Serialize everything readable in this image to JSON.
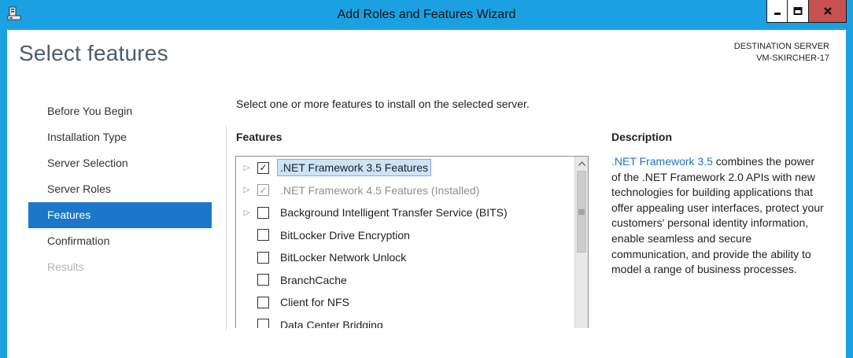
{
  "window": {
    "title": "Add Roles and Features Wizard"
  },
  "header": {
    "page_title": "Select features",
    "destination_label": "DESTINATION SERVER",
    "destination_server": "VM-SKIRCHER-17"
  },
  "nav": {
    "items": [
      {
        "label": "Before You Begin",
        "state": "normal"
      },
      {
        "label": "Installation Type",
        "state": "normal"
      },
      {
        "label": "Server Selection",
        "state": "normal"
      },
      {
        "label": "Server Roles",
        "state": "normal"
      },
      {
        "label": "Features",
        "state": "selected"
      },
      {
        "label": "Confirmation",
        "state": "normal"
      },
      {
        "label": "Results",
        "state": "disabled"
      }
    ]
  },
  "main": {
    "instructions": "Select one or more features to install on the selected server.",
    "features_heading": "Features",
    "features": [
      {
        "label": ".NET Framework 3.5 Features",
        "checked": true,
        "expandable": true,
        "selected": true,
        "installed": false
      },
      {
        "label": ".NET Framework 4.5 Features (Installed)",
        "checked": true,
        "expandable": true,
        "selected": false,
        "installed": true
      },
      {
        "label": "Background Intelligent Transfer Service (BITS)",
        "checked": false,
        "expandable": true,
        "selected": false,
        "installed": false
      },
      {
        "label": "BitLocker Drive Encryption",
        "checked": false,
        "expandable": false,
        "selected": false,
        "installed": false
      },
      {
        "label": "BitLocker Network Unlock",
        "checked": false,
        "expandable": false,
        "selected": false,
        "installed": false
      },
      {
        "label": "BranchCache",
        "checked": false,
        "expandable": false,
        "selected": false,
        "installed": false
      },
      {
        "label": "Client for NFS",
        "checked": false,
        "expandable": false,
        "selected": false,
        "installed": false
      },
      {
        "label": "Data Center Bridging",
        "checked": false,
        "expandable": false,
        "selected": false,
        "installed": false
      }
    ],
    "description_heading": "Description",
    "description_link": ".NET Framework 3.5",
    "description_text": " combines the power of the .NET Framework 2.0 APIs with new technologies for building applications that offer appealing user interfaces, protect your customers' personal identity information, enable seamless and secure communication, and provide the ability to model a range of business processes."
  },
  "icons": {
    "app": "server-manager-icon",
    "minimize": "minimize-icon",
    "maximize": "maximize-icon",
    "close": "close-icon",
    "expander": "triangle-right-icon",
    "checkmark": "checkmark-icon",
    "scroll_up": "chevron-up-icon",
    "scroll_grip": "grip-icon"
  },
  "colors": {
    "titlebar": "#1ba1e2",
    "nav_selected": "#1b77c9",
    "close_button": "#c75050",
    "link": "#1f73bf",
    "title_text": "#4d5d6b"
  }
}
